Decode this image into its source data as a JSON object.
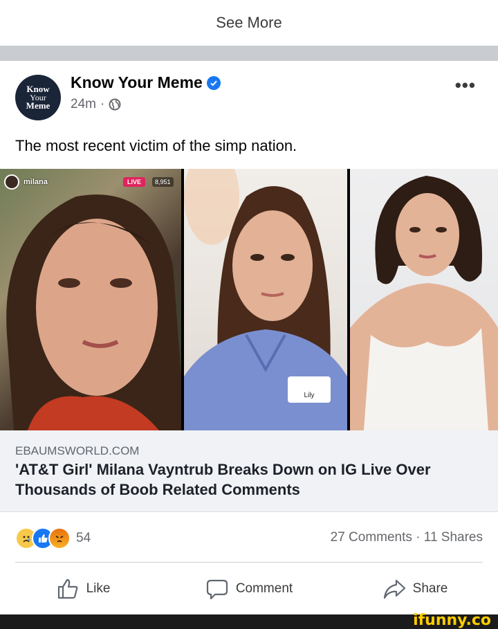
{
  "top": {
    "see_more": "See More"
  },
  "post": {
    "avatar": {
      "line1": "Know",
      "line2": "Your",
      "line3": "Meme"
    },
    "page_name": "Know Your Meme",
    "time": "24m",
    "separator": "·",
    "caption": "The most recent victim of the simp nation."
  },
  "live_overlay": {
    "username": "milana",
    "live": "LIVE",
    "viewers": "8,951"
  },
  "name_tag": "Lily",
  "link": {
    "domain": "EBAUMSWORLD.COM",
    "title": "'AT&T Girl' Milana Vayntrub Breaks Down on IG Live Over Thousands of Boob Related Comments"
  },
  "stats": {
    "reaction_count": "54",
    "comments": "27 Comments",
    "dot": "·",
    "shares": "11 Shares"
  },
  "actions": {
    "like": "Like",
    "comment": "Comment",
    "share": "Share"
  },
  "watermark": "ifunny.co",
  "colors": {
    "accent": "#1877f2",
    "ifunny": "#ffcc00"
  }
}
